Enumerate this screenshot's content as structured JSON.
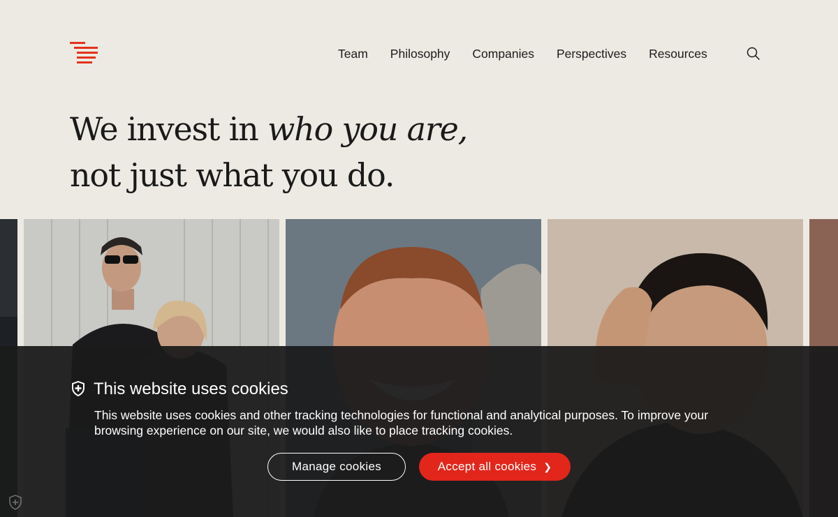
{
  "header": {
    "nav": [
      {
        "label": "Team"
      },
      {
        "label": "Philosophy"
      },
      {
        "label": "Companies"
      },
      {
        "label": "Perspectives"
      },
      {
        "label": "Resources"
      }
    ],
    "search_icon": "search-icon"
  },
  "hero": {
    "line1_start": "We invest in ",
    "line1_emphasis": "who you are,",
    "line2": "not just what you do."
  },
  "cookie_banner": {
    "icon": "shield-icon",
    "title": "This website uses cookies",
    "text": "This website uses cookies and other tracking technologies for functional and analytical purposes. To improve your browsing experience on our site, we would also like to place tracking cookies.",
    "manage_label": "Manage cookies",
    "accept_label": "Accept all cookies",
    "accept_chevron": "❯"
  },
  "colors": {
    "background": "#edeae3",
    "brand_red": "#e3321c",
    "accept_button": "#e2261b",
    "banner": "#1b1b1b",
    "text": "#1c1c1c"
  }
}
